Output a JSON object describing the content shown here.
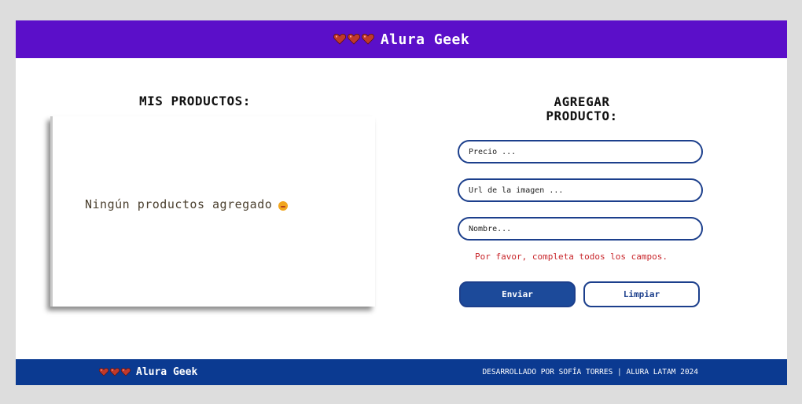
{
  "header": {
    "brand": "Alura Geek"
  },
  "products": {
    "title": "MIS PRODUCTOS:",
    "empty_message": "Ningún productos agregado"
  },
  "form": {
    "title_line1": "AGREGAR",
    "title_line2": "PRODUCTO:",
    "price_placeholder": "Precio ...",
    "image_placeholder": "Url de la imagen ...",
    "name_placeholder": "Nombre...",
    "error": "Por favor, completa todos los campos.",
    "submit_label": "Enviar",
    "clear_label": "Limpiar"
  },
  "footer": {
    "brand": "Alura Geek",
    "credit": "DESARROLLADO POR SOFÍA TORRES | ALURA LATAM 2024"
  },
  "colors": {
    "header_bg": "#5b0fc9",
    "footer_bg": "#0b3a91",
    "accent": "#1c3f8c",
    "error": "#c8252a",
    "heart": "#c0392b"
  },
  "icons": [
    "heart-icon",
    "sad-face-icon"
  ]
}
